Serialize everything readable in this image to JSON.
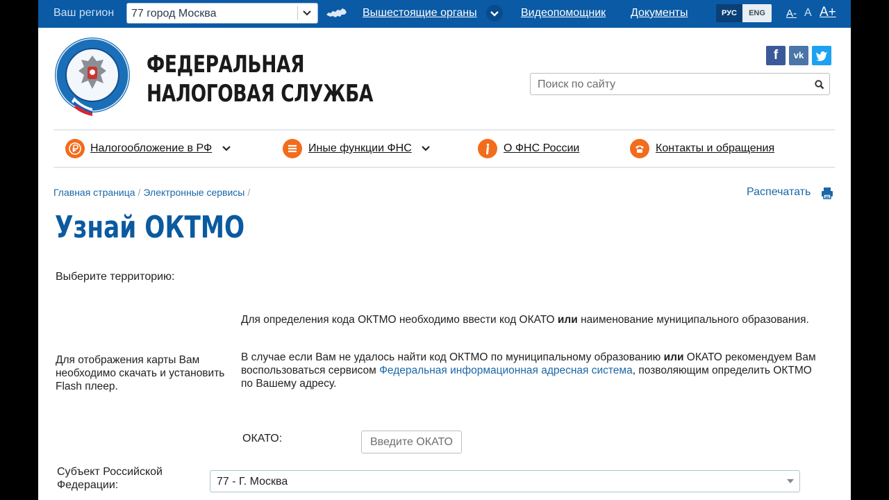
{
  "topbar": {
    "region_label": "Ваш регион",
    "region_value": "77 город Москва",
    "links": {
      "superior": "Вышестоящие органы",
      "video": "Видеопомощник",
      "docs": "Документы"
    },
    "lang": {
      "rus": "РУС",
      "eng": "ENG"
    },
    "font_size": {
      "minus": "A-",
      "normal": "A",
      "plus": "A+"
    }
  },
  "header": {
    "title_line1": "ФЕДЕРАЛЬНАЯ",
    "title_line2": "НАЛОГОВАЯ СЛУЖБА",
    "social": {
      "facebook": "f",
      "vk": "vk",
      "twitter": "t"
    },
    "search_placeholder": "Поиск по сайту"
  },
  "nav": {
    "items": [
      {
        "label": "Налогообложение в РФ",
        "icon": "ruble-icon"
      },
      {
        "label": "Иные функции ФНС",
        "icon": "menu-icon"
      },
      {
        "label": "О ФНС России",
        "icon": "info-icon"
      },
      {
        "label": "Контакты и обращения",
        "icon": "phone-icon"
      }
    ]
  },
  "breadcrumb": {
    "items": [
      "Главная страница",
      "Электронные сервисы"
    ]
  },
  "print_label": "Распечатать",
  "page_title": "Узнай ОКТМО",
  "content": {
    "choose_territory": "Выберите территорию:",
    "flash_note": "Для отображения карты Вам необходимо скачать и установить Flash плеер.",
    "info1": {
      "part1": "Для определения кода ОКТМО необходимо ввести код ОКАТО ",
      "bold": "или",
      "part2": " наименование муниципального образования."
    },
    "info2": {
      "part1": "В случае если Вам не удалось найти код ОКТМО по муниципальному образованию ",
      "bold": "или",
      "part2": " ОКАТО рекомендуем Вам воспользоваться сервисом ",
      "link": "Федеральная информационная адресная система",
      "part3": ", позволяющим определить ОКТМО по Вашему адресу."
    },
    "okato_label": "ОКАТО:",
    "okato_placeholder": "Введите ОКАТО",
    "subject_label": "Субъект Российской Федерации:",
    "subject_value": "77 - Г. Москва"
  },
  "colors": {
    "topbar": "#0a5aa5",
    "accent_orange": "#f26c1c",
    "title_blue": "#0b5aa0",
    "link_blue": "#1a67a8"
  }
}
